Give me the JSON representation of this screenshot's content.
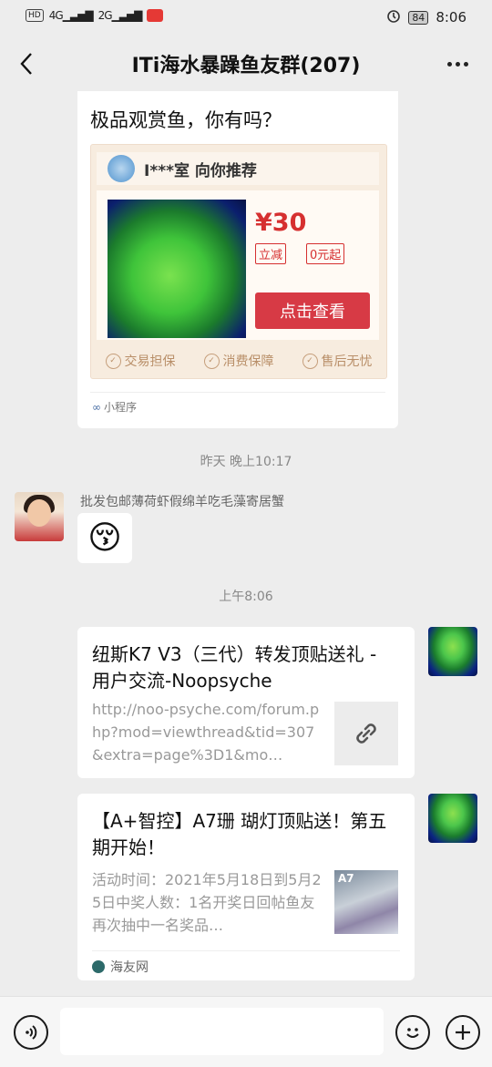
{
  "status_bar": {
    "network_hd": "HD",
    "signal_1": "4G",
    "signal_2": "2G",
    "battery": "84",
    "time": "8:06"
  },
  "nav": {
    "title": "ITi海水暴躁鱼友群(207)",
    "back_icon": "chevron-left-icon",
    "more_icon": "more-dots-icon"
  },
  "messages": {
    "mini_program": {
      "title": "极品观赏鱼，你有吗？",
      "recommender": "I***室 向你推荐",
      "price": "¥30",
      "tag_discount": "立减",
      "tag_start": "0元起",
      "view_button": "点击查看",
      "guarantees": [
        "交易担保",
        "消费保障",
        "售后无忧"
      ],
      "footer": "小程序"
    },
    "time_yesterday": "昨天 晚上10:17",
    "friend": {
      "name": "批发包邮薄荷虾假绵羊吃毛藻寄居蟹",
      "emoji": "😚"
    },
    "time_today": "上午8:06",
    "link1": {
      "title": "纽斯K7 V3（三代）转发顶贴送礼 - 用户交流-Noopsyche",
      "desc": "http://noo-psyche.com/forum.php?mod=viewthread&tid=307&extra=page%3D1&mo…",
      "thumb_icon": "link-icon"
    },
    "link2": {
      "title": "【A+智控】A7珊 瑚灯顶贴送！第五期开始！",
      "desc": "活动时间：2021年5月18日到5月25日中奖人数：1名开奖日回帖鱼友再次抽中一名奖品…",
      "thumb_text": "A7",
      "source": "海友网"
    }
  },
  "input_bar": {
    "voice_icon": "voice-icon",
    "emoji_icon": "emoji-icon",
    "plus_icon": "plus-icon"
  }
}
